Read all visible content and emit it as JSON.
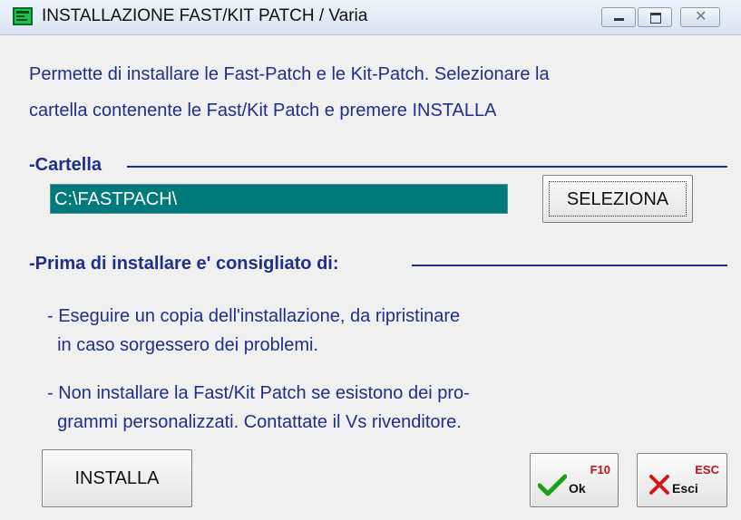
{
  "window": {
    "title": "INSTALLAZIONE FAST/KIT PATCH / Varia",
    "close_glyph": "✕"
  },
  "intro": {
    "line1": "Permette di installare le Fast-Patch e le Kit-Patch. Selezionare la",
    "line2": "cartella contenente le Fast/Kit Patch e premere INSTALLA"
  },
  "cartella": {
    "section_title": "-Cartella",
    "path_value": "C:\\FASTPACH\\",
    "select_button": "SELEZIONA"
  },
  "advice": {
    "section_title": "-Prima di installare e' consigliato di:",
    "note1": "- Eseguire un copia dell'installazione, da ripristinare\n  in caso sorgessero dei problemi.",
    "note2": "- Non installare la Fast/Kit Patch se esistono dei pro-\n  grammi personalizzati. Contattate il Vs rivenditore."
  },
  "actions": {
    "install_button": "INSTALLA",
    "ok_key": "F10",
    "ok_label": "Ok",
    "esc_key": "ESC",
    "esc_label": "Esci"
  },
  "colors": {
    "text_blue": "#1e2f8c",
    "path_field_bg": "#007a7a",
    "ok_check": "#1aa11a",
    "esc_cross": "#d01818"
  },
  "icons": {
    "app": "app-icon",
    "ok": "checkmark-icon",
    "esc": "cross-icon"
  }
}
